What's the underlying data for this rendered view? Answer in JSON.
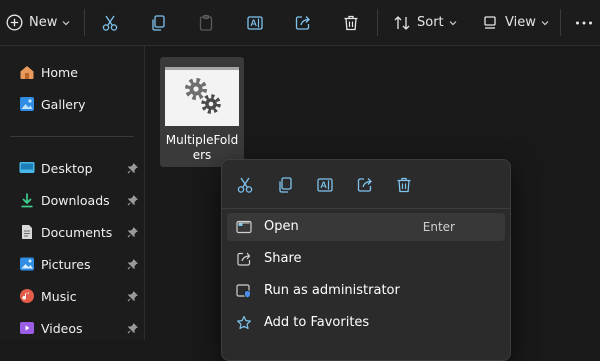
{
  "toolbar": {
    "new_label": "New",
    "sort_label": "Sort",
    "view_label": "View",
    "icons": [
      "plus-circle-icon",
      "cut-icon",
      "copy-icon",
      "paste-icon",
      "rename-icon",
      "share-icon",
      "delete-icon",
      "sort-icon",
      "view-icon",
      "more-icon"
    ]
  },
  "sidebar": {
    "items": [
      {
        "label": "Home",
        "icon": "home-icon"
      },
      {
        "label": "Gallery",
        "icon": "gallery-icon"
      },
      {
        "label": "Desktop",
        "icon": "desktop-icon",
        "pinned": true
      },
      {
        "label": "Downloads",
        "icon": "download-icon",
        "pinned": true
      },
      {
        "label": "Documents",
        "icon": "documents-icon",
        "pinned": true
      },
      {
        "label": "Pictures",
        "icon": "pictures-icon",
        "pinned": true
      },
      {
        "label": "Music",
        "icon": "music-icon",
        "pinned": true
      },
      {
        "label": "Videos",
        "icon": "videos-icon",
        "pinned": true
      }
    ]
  },
  "file": {
    "name": "MultipleFolders",
    "icon": "gear-icon"
  },
  "context_menu": {
    "top_icons": [
      "cut-icon",
      "copy-icon",
      "rename-icon",
      "share-icon",
      "delete-icon"
    ],
    "items": [
      {
        "label": "Open",
        "shortcut": "Enter",
        "icon": "open-icon",
        "highlighted": true
      },
      {
        "label": "Share",
        "icon": "share-icon"
      },
      {
        "label": "Run as administrator",
        "icon": "shield-icon"
      },
      {
        "label": "Add to Favorites",
        "icon": "star-icon"
      }
    ]
  },
  "colors": {
    "background": "#191919",
    "panel": "#1c1c1c",
    "menu": "#2b2b2b",
    "highlight": "#383838",
    "accent": "#4cc2ff"
  }
}
